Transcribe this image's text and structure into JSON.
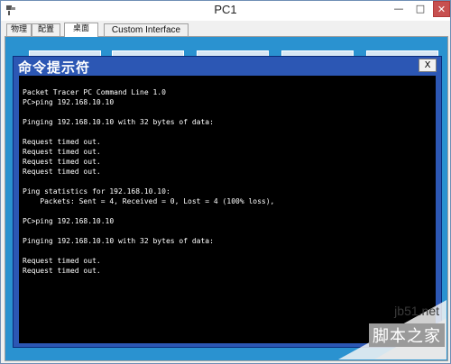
{
  "window": {
    "title": "PC1",
    "minimize_glyph": "—",
    "maximize_glyph": "□",
    "close_glyph": "✕"
  },
  "tabs": [
    {
      "label": "物理",
      "active": false
    },
    {
      "label": "配置",
      "active": false
    },
    {
      "label": "桌面",
      "active": true
    },
    {
      "label": "Custom Interface",
      "active": false
    }
  ],
  "command_prompt": {
    "title": "命令提示符",
    "close_label": "X",
    "output": "Packet Tracer PC Command Line 1.0\nPC>ping 192.168.10.10\n\nPinging 192.168.10.10 with 32 bytes of data:\n\nRequest timed out.\nRequest timed out.\nRequest timed out.\nRequest timed out.\n\nPing statistics for 192.168.10.10:\n    Packets: Sent = 4, Received = 0, Lost = 4 (100% loss),\n\nPC>ping 192.168.10.10\n\nPinging 192.168.10.10 with 32 bytes of data:\n\nRequest timed out.\nRequest timed out."
  },
  "watermark": {
    "url": "jb51.net",
    "name": "脚本之家"
  },
  "colors": {
    "desktop_bg": "#2a92d0",
    "cmd_titlebar": "#2c57b4",
    "terminal_bg": "#000000",
    "terminal_fg": "#ffffff",
    "close_button": "#c75050"
  }
}
